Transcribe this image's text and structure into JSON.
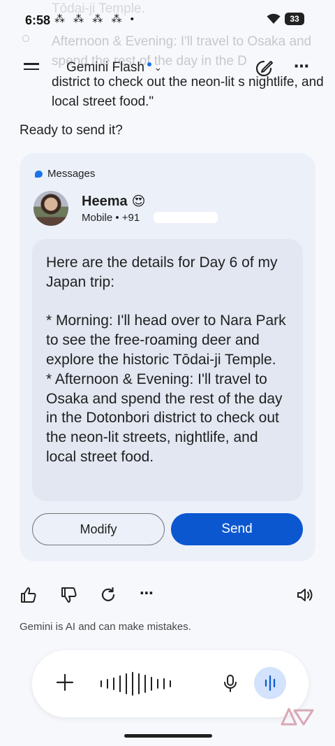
{
  "status_bar": {
    "time": "6:58",
    "notifications": "⁂ ⁂ ⁂ ⁂ •",
    "battery": "33"
  },
  "background_text": {
    "top_fragment": "Tōdai-ji Temple.",
    "faded_lines": "Afternoon & Evening: I'll travel to Osaka and spend the rest of the day in the D",
    "visible_lines": "district to check out the neon-lit s nightlife, and local street food.\""
  },
  "header": {
    "model_name": "Gemini Flash",
    "menu_icon": "menu-icon",
    "edit_icon": "edit-icon",
    "more_icon": "more-icon"
  },
  "prompt": {
    "ready_text": "Ready to send it?"
  },
  "card": {
    "app_name": "Messages",
    "contact_name": "Heema",
    "contact_emoji": "😍",
    "contact_sub": "Mobile • +91",
    "message": "Here are the details for Day 6 of my Japan trip:\n\n* Morning: I'll head over to Nara Park to see the free-roaming deer and explore the historic Tōdai-ji Temple.\n* Afternoon & Evening: I'll travel to Osaka and spend the rest of the day in the Dotonbori district to check out the neon-lit streets, nightlife, and local street food.",
    "modify_label": "Modify",
    "send_label": "Send",
    "send_color": "#0b57d0"
  },
  "actions": {
    "thumbs_up": "thumbs-up-icon",
    "thumbs_down": "thumbs-down-icon",
    "regenerate": "regenerate-icon",
    "more": "⋯",
    "speaker": "speaker-icon"
  },
  "disclaimer": "Gemini is AI and can make mistakes.",
  "input_bar": {
    "plus": "plus-icon",
    "mic": "mic-icon",
    "live": "live-voice-icon"
  }
}
